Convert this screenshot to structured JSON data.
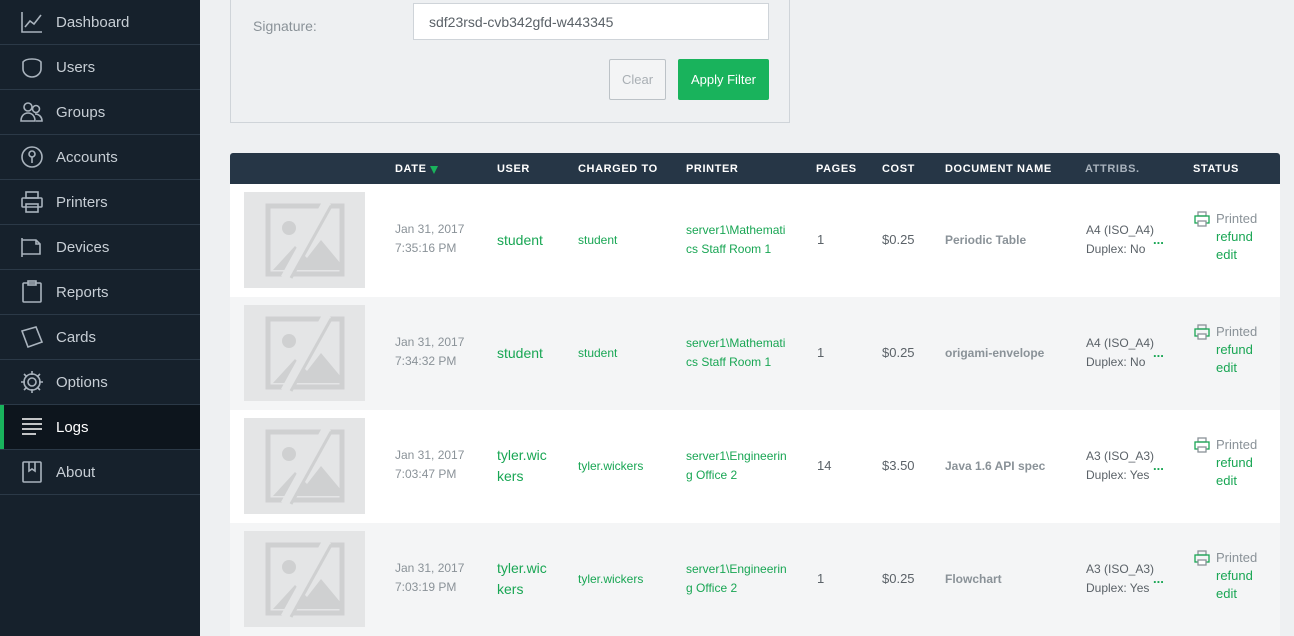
{
  "sidebar": {
    "items": [
      {
        "label": "Dashboard",
        "icon": "dashboard-icon"
      },
      {
        "label": "Users",
        "icon": "users-icon"
      },
      {
        "label": "Groups",
        "icon": "groups-icon"
      },
      {
        "label": "Accounts",
        "icon": "accounts-icon"
      },
      {
        "label": "Printers",
        "icon": "printer-icon"
      },
      {
        "label": "Devices",
        "icon": "devices-icon"
      },
      {
        "label": "Reports",
        "icon": "reports-icon"
      },
      {
        "label": "Cards",
        "icon": "cards-icon"
      },
      {
        "label": "Options",
        "icon": "gear-icon"
      },
      {
        "label": "Logs",
        "icon": "logs-icon",
        "active": true
      },
      {
        "label": "About",
        "icon": "about-icon"
      }
    ]
  },
  "filter": {
    "signature_label": "Signature:",
    "signature_value": "sdf23rsd-cvb342gfd-w443345",
    "clear_label": "Clear",
    "apply_label": "Apply Filter"
  },
  "table": {
    "headers": {
      "date": "DATE",
      "user": "USER",
      "charged_to": "CHARGED TO",
      "printer": "PRINTER",
      "pages": "PAGES",
      "cost": "COST",
      "document_name": "DOCUMENT NAME",
      "attribs": "ATTRIBS.",
      "status": "STATUS"
    },
    "rows": [
      {
        "date": "Jan 31, 2017",
        "time": "7:35:16 PM",
        "user": "student",
        "charged_to": "student",
        "printer": "server1\\Mathematics Staff Room 1",
        "pages": "1",
        "cost": "$0.25",
        "document": "Periodic Table",
        "attr1": "A4 (ISO_A4)",
        "attr2": "Duplex: No",
        "more": "...",
        "status": "Printed",
        "refund": "refund",
        "edit": "edit"
      },
      {
        "date": "Jan 31, 2017",
        "time": "7:34:32 PM",
        "user": "student",
        "charged_to": "student",
        "printer": "server1\\Mathematics Staff Room 1",
        "pages": "1",
        "cost": "$0.25",
        "document": "origami-envelope",
        "attr1": "A4 (ISO_A4)",
        "attr2": "Duplex: No",
        "more": "...",
        "status": "Printed",
        "refund": "refund",
        "edit": "edit"
      },
      {
        "date": "Jan 31, 2017",
        "time": "7:03:47 PM",
        "user": "tyler.wickers",
        "charged_to": "tyler.wickers",
        "printer": "server1\\Engineering Office 2",
        "pages": "14",
        "cost": "$3.50",
        "document": "Java 1.6 API spec",
        "attr1": "A3 (ISO_A3)",
        "attr2": "Duplex: Yes",
        "more": "...",
        "status": "Printed",
        "refund": "refund",
        "edit": "edit"
      },
      {
        "date": "Jan 31, 2017",
        "time": "7:03:19 PM",
        "user": "tyler.wickers",
        "charged_to": "tyler.wickers",
        "printer": "server1\\Engineering Office 2",
        "pages": "1",
        "cost": "$0.25",
        "document": "Flowchart",
        "attr1": "A3 (ISO_A3)",
        "attr2": "Duplex: Yes",
        "more": "...",
        "status": "Printed",
        "refund": "refund",
        "edit": "edit"
      }
    ]
  },
  "colors": {
    "sidebar_bg": "#16212c",
    "accent": "#19b35c",
    "header_bg": "#263646",
    "link": "#19a654"
  }
}
